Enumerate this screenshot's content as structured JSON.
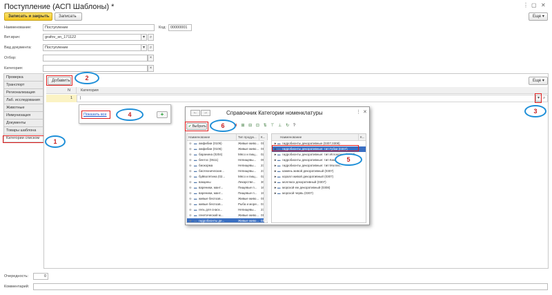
{
  "window": {
    "title": "Поступление (АСП Шаблоны) *",
    "controls": [
      "⋮",
      "▢",
      "✕"
    ]
  },
  "toolbar": {
    "save_close_label": "Записать и закрыть",
    "save_label": "Записать",
    "more_label": "Еще",
    "more_arrow": "▾"
  },
  "form": {
    "name_label": "Наименование:",
    "name_value": "Поступление",
    "code_label": "Код:",
    "code_value": "00000001",
    "vet_label": "Вет.врач:",
    "vet_value": "grafov_sn_171122",
    "doctype_label": "Вид документа:",
    "doctype_value": "Поступление",
    "filter_label": "Отбор:",
    "filter_value": "",
    "category_label": "Категория:",
    "category_value": ""
  },
  "sidebar": {
    "items": [
      {
        "label": "Проверка"
      },
      {
        "label": "Транспорт"
      },
      {
        "label": "Регионализация"
      },
      {
        "label": "Лаб. исследования"
      },
      {
        "label": "Животные"
      },
      {
        "label": "Иммунизация"
      },
      {
        "label": "Документы"
      },
      {
        "label": "Товары шаблона"
      },
      {
        "label": "Категории списком"
      }
    ]
  },
  "table": {
    "add_label": "Добавить",
    "more_label": "Еще",
    "more_arrow": "▾",
    "col_n": "N",
    "col_category": "Категория",
    "row_number": "1",
    "row_category": "",
    "dropdown_btn": "▾",
    "open_btn": "⌕"
  },
  "dropdown": {
    "show_all": "Показать все",
    "add_symbol": "+"
  },
  "dialog": {
    "title": "Справочник Категории номенклатуры",
    "back": "←",
    "forward": "→",
    "close": "✕",
    "more": "⋮",
    "select_label": "Выбрать",
    "tool_icons": [
      "⊕",
      "▣",
      "✎",
      "✖",
      "⊞",
      "⊟",
      "⊡",
      "⇅",
      "⊤",
      "⊥",
      "↻",
      "?"
    ],
    "left_headers": [
      "Наименование",
      "Тип продук...",
      "К..."
    ],
    "right_headers": [
      "Наименование",
      "К..."
    ],
    "left_rows": [
      {
        "name": "амфибии (0106)",
        "type": "Живые живо...",
        "k": "01"
      },
      {
        "name": "амфибии (0106)",
        "type": "Живые живо...",
        "k": "01"
      },
      {
        "name": "баранина (0204)",
        "type": "Мясо и пищ...",
        "k": "02"
      },
      {
        "name": "бентос (0511)",
        "type": "Непищевы...",
        "k": "05"
      },
      {
        "name": "биокорма",
        "type": "Непищевы...",
        "k": "23"
      },
      {
        "name": "биотехнические...",
        "type": "Непищевы...",
        "k": "23"
      },
      {
        "name": "буйволятина (02...",
        "type": "Мясо и пищ...",
        "k": "02"
      },
      {
        "name": "вакцины",
        "type": "Лекарстве...",
        "k": "30"
      },
      {
        "name": "вареники, мант...",
        "type": "Пищевые п...",
        "k": "16"
      },
      {
        "name": "вареники, мант...",
        "type": "Пищевые п...",
        "k": "19"
      },
      {
        "name": "живые беспозв...",
        "type": "Живые живо...",
        "k": "01"
      },
      {
        "name": "живые беспозв...",
        "type": "Рыба и море...",
        "k": "03"
      },
      {
        "name": "гель для снаск...",
        "type": "Непищевы...",
        "k": "23"
      },
      {
        "name": "генетический м...",
        "type": "Живые живо...",
        "k": "01"
      },
      {
        "name": "гидробионты де...",
        "type": "Живые живо...",
        "k": "01"
      }
    ],
    "right_rows": [
      {
        "name": "гидробионты декоративные (0307,0308)",
        "k": ""
      },
      {
        "name": "гидробионты декоративные: тип Губки (0307)",
        "k": ""
      },
      {
        "name": "гидробионты декоративные: тип Иглокожие (0308)",
        "k": ""
      },
      {
        "name": "гидробионты декоративные: тип Кишечн...",
        "k": ""
      },
      {
        "name": "гидробионты декоративные: тип Моллю...",
        "k": ""
      },
      {
        "name": "камень живой декоративный (0307)",
        "k": ""
      },
      {
        "name": "коралл живой декоративный (0307)",
        "k": ""
      },
      {
        "name": "моллюск декоративный (0307)",
        "k": ""
      },
      {
        "name": "морской еж декоративный (0308)",
        "k": ""
      },
      {
        "name": "морской червь (0307)",
        "k": ""
      }
    ]
  },
  "bottom": {
    "priority_label": "Очередность:",
    "priority_value": "0",
    "comment_label": "Комментарий:",
    "comment_value": ""
  },
  "markers": [
    "1",
    "2",
    "3",
    "4",
    "5",
    "6"
  ],
  "colors": {
    "accent_yellow": "#f3c523",
    "marker_red": "#e01b1b",
    "marker_blue": "#1e8fd8",
    "selection_blue": "#3a6fc2",
    "row_yellow": "#fbf3c4"
  }
}
